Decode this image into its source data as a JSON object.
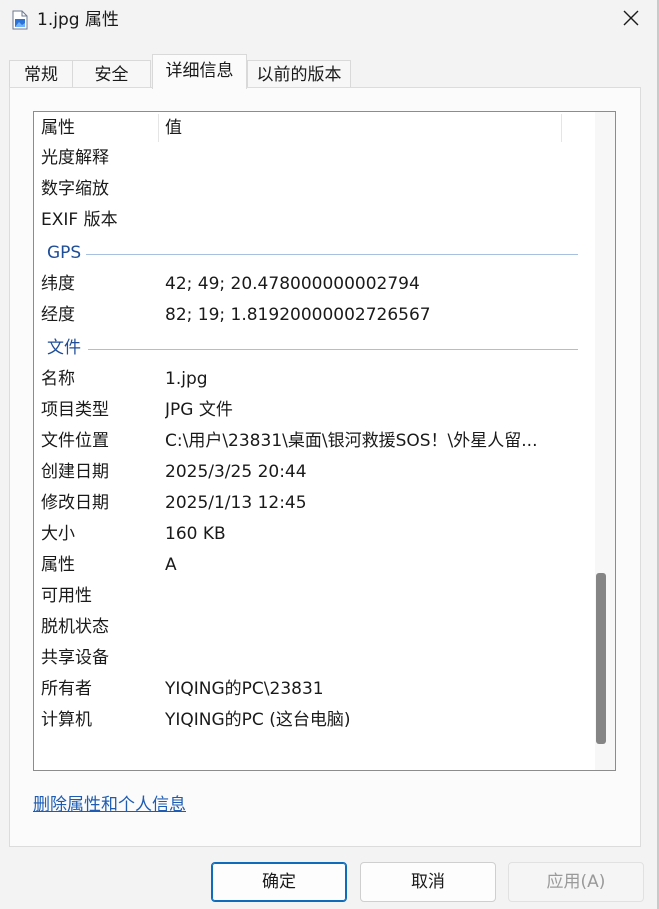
{
  "window": {
    "title": "1.jpg 属性",
    "icon": "image-file-icon",
    "close_icon": "close-icon"
  },
  "tabs": [
    {
      "label": "常规",
      "active": false
    },
    {
      "label": "安全",
      "active": false
    },
    {
      "label": "详细信息",
      "active": true
    },
    {
      "label": "以前的版本",
      "active": false
    }
  ],
  "details": {
    "header": {
      "property": "属性",
      "value": "值"
    },
    "rows_top": [
      {
        "key": "光度解释",
        "value": ""
      },
      {
        "key": "数字缩放",
        "value": ""
      },
      {
        "key": "EXIF 版本",
        "value": ""
      }
    ],
    "gps": {
      "label": "GPS",
      "rows": [
        {
          "key": "纬度",
          "value": "42; 49; 20.478000000002794"
        },
        {
          "key": "经度",
          "value": "82; 19; 1.81920000002726567"
        }
      ]
    },
    "file": {
      "label": "文件",
      "rows": [
        {
          "key": "名称",
          "value": "1.jpg"
        },
        {
          "key": "项目类型",
          "value": "JPG 文件"
        },
        {
          "key": "文件位置",
          "value": "C:\\用户\\23831\\桌面\\银河救援SOS！\\外星人留..."
        },
        {
          "key": "创建日期",
          "value": "2025/3/25 20:44"
        },
        {
          "key": "修改日期",
          "value": "2025/1/13 12:45"
        },
        {
          "key": "大小",
          "value": "160 KB"
        },
        {
          "key": "属性",
          "value": "A"
        },
        {
          "key": "可用性",
          "value": ""
        },
        {
          "key": "脱机状态",
          "value": ""
        },
        {
          "key": "共享设备",
          "value": ""
        },
        {
          "key": "所有者",
          "value": "YIQING的PC\\23831"
        },
        {
          "key": "计算机",
          "value": "YIQING的PC (这台电脑)"
        }
      ]
    }
  },
  "link": {
    "label": "删除属性和个人信息"
  },
  "buttons": {
    "ok": "确定",
    "cancel": "取消",
    "apply": "应用(A)"
  },
  "colors": {
    "group_label": "#1f4e99",
    "link": "#1e5cb3",
    "primary_border": "#0f6cbd"
  }
}
